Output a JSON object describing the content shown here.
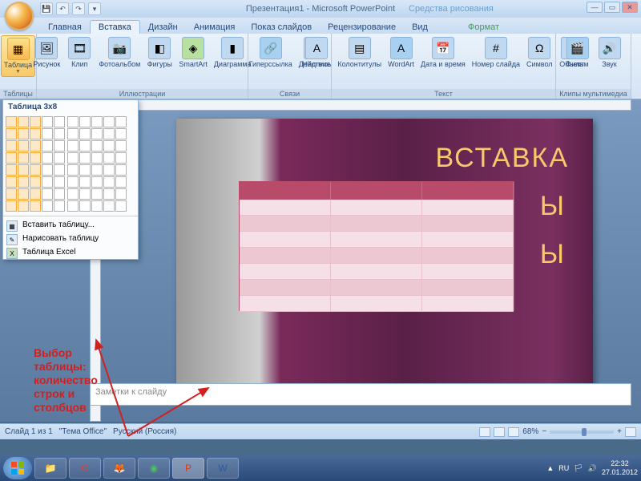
{
  "titlebar": {
    "title": "Презентация1 - Microsoft PowerPoint",
    "context_tab_group": "Средства рисования"
  },
  "tabs": {
    "home": "Главная",
    "insert": "Вставка",
    "design": "Дизайн",
    "animation": "Анимация",
    "slideshow": "Показ слайдов",
    "review": "Рецензирование",
    "view": "Вид",
    "format": "Формат"
  },
  "ribbon": {
    "table": "Таблица",
    "tables_group": "Таблицы",
    "picture": "Рисунок",
    "clip": "Клип",
    "photoalbum": "Фотоальбом",
    "shapes": "Фигуры",
    "smartart": "SmartArt",
    "chart": "Диаграмма",
    "illus_group": "Иллюстрации",
    "hyperlink": "Гиперссылка",
    "action": "Действие",
    "links_group": "Связи",
    "textbox": "Надпись",
    "headerfooter": "Колонтитулы",
    "wordart": "WordArt",
    "datetime": "Дата и время",
    "slidenum": "Номер слайда",
    "symbol": "Символ",
    "object": "Объект",
    "text_group": "Текст",
    "movie": "Фильм",
    "sound": "Звук",
    "media_group": "Клипы мультимедиа"
  },
  "table_dropdown": {
    "title": "Таблица 3x8",
    "insert_table": "Вставить таблицу...",
    "draw_table": "Нарисовать таблицу",
    "excel_table": "Таблица Excel"
  },
  "slide": {
    "title": "ВСТАВКА",
    "line2": "Ы",
    "line3": "Ы"
  },
  "notes": {
    "placeholder": "Заметки к слайду"
  },
  "annotation": {
    "text": "Выбор\nтаблицы:\nколичество\nстрок и\nстолбцов"
  },
  "statusbar": {
    "left": "Слайд 1 из 1",
    "theme": "\"Тема Office\"",
    "lang": "Русский (Россия)",
    "zoom": "68%"
  },
  "tray": {
    "lang": "RU",
    "time": "22:32",
    "date": "27.01.2012"
  }
}
